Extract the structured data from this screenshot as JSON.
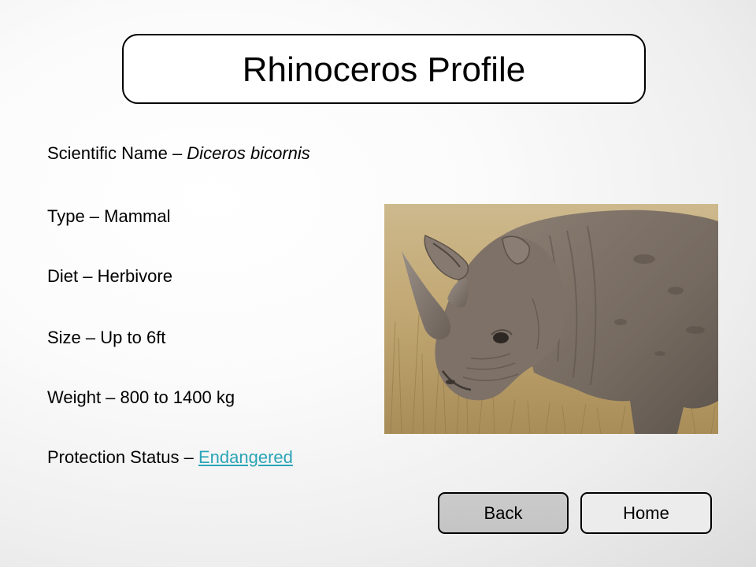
{
  "title": "Rhinoceros Profile",
  "facts": {
    "scientific_name_label": "Scientific Name – ",
    "scientific_name_value": "Diceros bicornis",
    "type": "Type – Mammal",
    "diet": "Diet – Herbivore",
    "size": "Size – Up to 6ft",
    "weight": "Weight – 800 to 1400 kg",
    "protection_label": "Protection Status – ",
    "protection_value": "Endangered"
  },
  "buttons": {
    "back": "Back",
    "home": "Home"
  },
  "colors": {
    "link": "#2aa4b7",
    "back_button": "#c8c8c8",
    "home_button": "#ececec"
  }
}
